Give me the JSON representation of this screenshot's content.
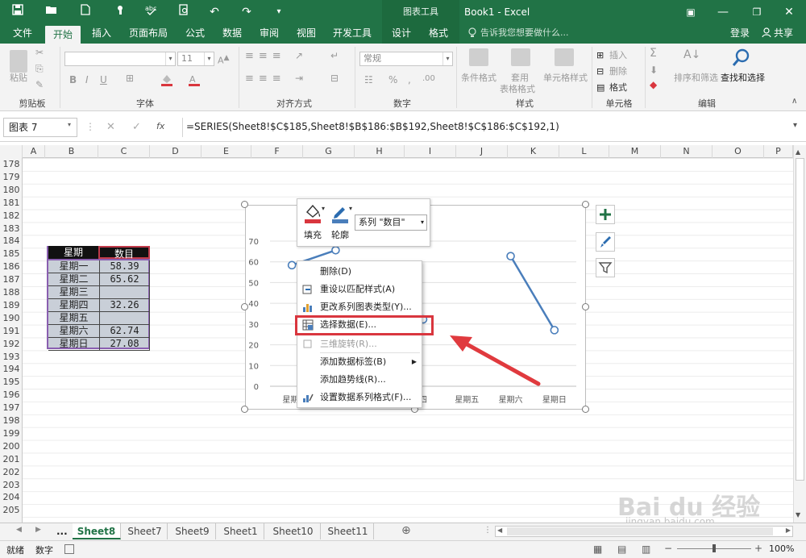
{
  "title_bar": {
    "app_title": "Book1 - Excel",
    "context_tools": "图表工具",
    "quick_access": [
      "save-icon",
      "open-icon",
      "new-icon",
      "touch-icon",
      "spell-icon",
      "preview-icon",
      "undo-icon",
      "redo-icon",
      "customize-icon"
    ],
    "window_buttons": [
      "ribbon-display-icon",
      "minimize-icon",
      "restore-icon",
      "close-icon"
    ]
  },
  "ribbon_tabs": {
    "file": "文件",
    "home": "开始",
    "insert": "插入",
    "page_layout": "页面布局",
    "formulas": "公式",
    "data": "数据",
    "review": "审阅",
    "view": "视图",
    "developer": "开发工具",
    "design": "设计",
    "format": "格式",
    "tell_me": "告诉我您想要做什么...",
    "login": "登录",
    "share": "共享"
  },
  "ribbon": {
    "clipboard": {
      "paste": "粘贴",
      "label": "剪贴板"
    },
    "font": {
      "size": "11",
      "label": "字体"
    },
    "alignment": {
      "label": "对齐方式"
    },
    "number": {
      "format": "常规",
      "label": "数字"
    },
    "styles": {
      "conditional": "条件格式",
      "table_format_1": "套用",
      "table_format_2": "表格格式",
      "cell_styles": "单元格样式",
      "label": "样式"
    },
    "cells": {
      "insert": "插入",
      "delete": "删除",
      "format": "格式",
      "label": "单元格"
    },
    "editing": {
      "sort_filter": "排序和筛选",
      "find_select": "查找和选择",
      "label": "编辑"
    }
  },
  "formula_bar": {
    "name_box": "图表 7",
    "fx": "fx",
    "formula": "=SERIES(Sheet8!$C$185,Sheet8!$B$186:$B$192,Sheet8!$C$186:$C$192,1)"
  },
  "columns": [
    "A",
    "B",
    "C",
    "D",
    "E",
    "F",
    "G",
    "H",
    "I",
    "J",
    "K",
    "L",
    "M",
    "N",
    "O",
    "P"
  ],
  "rows": [
    "178",
    "179",
    "180",
    "181",
    "182",
    "183",
    "184",
    "185",
    "186",
    "187",
    "188",
    "189",
    "190",
    "191",
    "192",
    "193",
    "194",
    "195",
    "196",
    "197",
    "198",
    "199",
    "200",
    "201",
    "202",
    "203",
    "204",
    "205"
  ],
  "table": {
    "header_day": "星期",
    "header_count": "数目",
    "rows": [
      {
        "day": "星期一",
        "count": "58.39"
      },
      {
        "day": "星期二",
        "count": "65.62"
      },
      {
        "day": "星期三",
        "count": ""
      },
      {
        "day": "星期四",
        "count": "32.26"
      },
      {
        "day": "星期五",
        "count": ""
      },
      {
        "day": "星期六",
        "count": "62.74"
      },
      {
        "day": "星期日",
        "count": "27.08"
      }
    ]
  },
  "chart_data": {
    "type": "line",
    "categories": [
      "星期一",
      "星期二",
      "星期三",
      "星期四",
      "星期五",
      "星期六",
      "星期日"
    ],
    "visible_category_labels": [
      "星期-",
      "",
      "",
      "四",
      "星期五",
      "星期六",
      "星期日"
    ],
    "series": [
      {
        "values": [
          58.39,
          65.62,
          null,
          32.26,
          null,
          62.74,
          27.08
        ]
      }
    ],
    "ylim": [
      0,
      70
    ],
    "yticks": [
      "0",
      "10",
      "20",
      "30",
      "40",
      "50",
      "60",
      "70"
    ],
    "grid": true,
    "colors": {
      "line": "#4a7ebb",
      "marker": "#4a7ebb"
    }
  },
  "mini_toolbar": {
    "fill": "填充",
    "outline": "轮廓",
    "series_selector": "系列 \"数目\""
  },
  "context_menu": {
    "items": [
      {
        "label": "删除(D)",
        "icon": "",
        "disabled": false
      },
      {
        "label": "重设以匹配样式(A)",
        "icon": "reset-style-icon",
        "disabled": false
      },
      {
        "label": "更改系列图表类型(Y)...",
        "icon": "chart-type-icon",
        "disabled": false
      },
      {
        "label": "选择数据(E)...",
        "icon": "select-data-icon",
        "disabled": false
      },
      {
        "label": "三维旋转(R)...",
        "icon": "rotate-3d-icon",
        "disabled": true
      },
      {
        "label": "添加数据标签(B)",
        "icon": "",
        "disabled": false,
        "submenu": true
      },
      {
        "label": "添加趋势线(R)...",
        "icon": "",
        "disabled": false
      },
      {
        "label": "设置数据系列格式(F)...",
        "icon": "format-series-icon",
        "disabled": false
      }
    ]
  },
  "sheet_tabs": {
    "ellipsis": "...",
    "tabs": [
      "Sheet8",
      "Sheet7",
      "Sheet9",
      "Sheet1",
      "Sheet10",
      "Sheet11"
    ],
    "active": "Sheet8"
  },
  "status_bar": {
    "ready": "就绪",
    "mode": "数字",
    "zoom": "100%"
  },
  "watermark": {
    "brand": "Bai du 经验",
    "url": "jingyan.baidu.com"
  },
  "colors": {
    "excel_green": "#217346",
    "highlight_red": "#d9363e",
    "arrow_red": "#e03a3e",
    "table_header_bg": "#111111",
    "table_cell_bg": "#c9cfd8"
  }
}
